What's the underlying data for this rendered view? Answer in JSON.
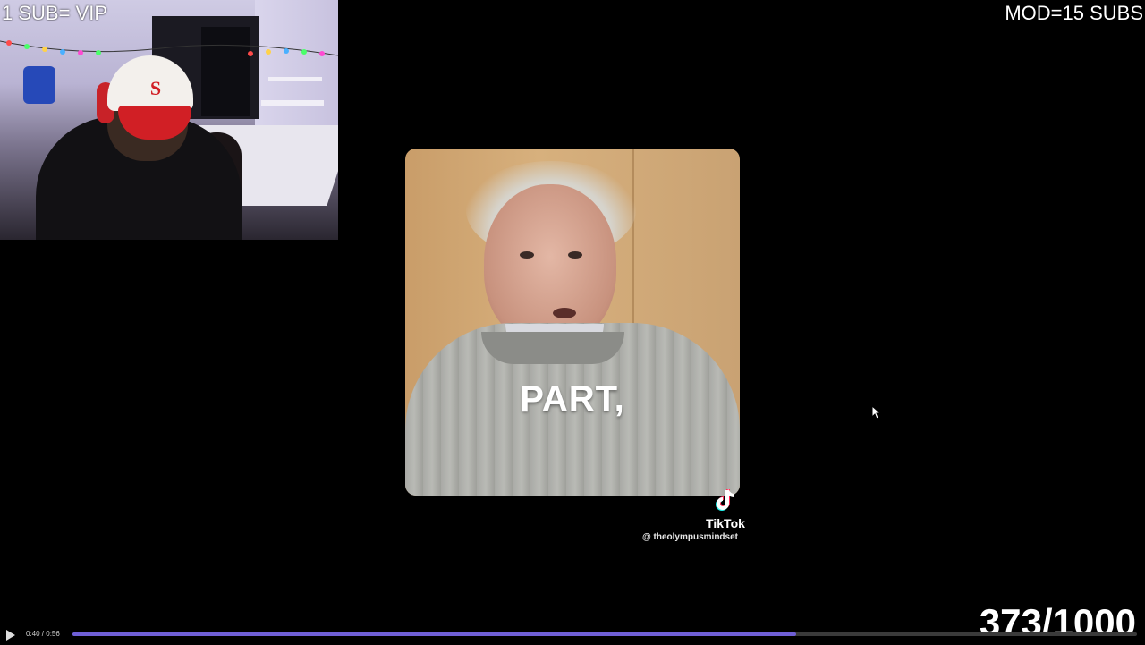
{
  "overlay": {
    "left_text": "1 SUB= VIP",
    "right_text": "MOD=15 SUBS"
  },
  "video": {
    "caption": "PART,",
    "platform": "TikTok",
    "handle": "@ theolympusmindset"
  },
  "counter": "373/1000",
  "player": {
    "time": "0:40 / 0:56",
    "progress": 0.68,
    "accent": "#6f5fd6"
  },
  "icons": {
    "play": "play-icon",
    "tiktok": "tiktok-logo-icon",
    "cursor": "mouse-cursor-icon"
  }
}
